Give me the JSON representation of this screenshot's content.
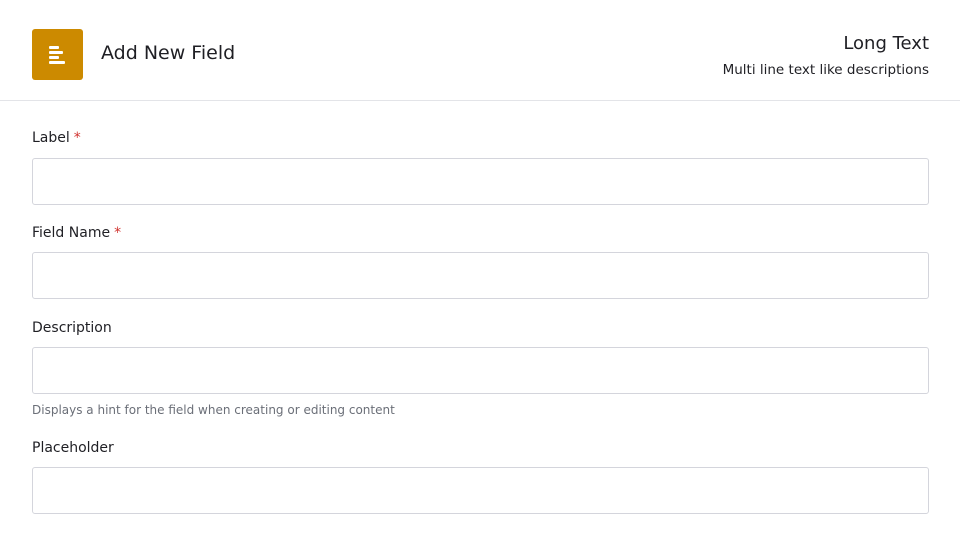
{
  "header": {
    "title": "Add New Field",
    "icon": "text-align-left-icon",
    "accent": "#cc8a00",
    "field_type": "Long Text",
    "field_type_description": "Multi line text like descriptions"
  },
  "form": {
    "label": {
      "label": "Label",
      "required_mark": "*",
      "value": ""
    },
    "field_name": {
      "label": "Field Name",
      "required_mark": "*",
      "value": ""
    },
    "description": {
      "label": "Description",
      "value": "",
      "hint": "Displays a hint for the field when creating or editing content"
    },
    "placeholder": {
      "label": "Placeholder",
      "value": ""
    }
  }
}
